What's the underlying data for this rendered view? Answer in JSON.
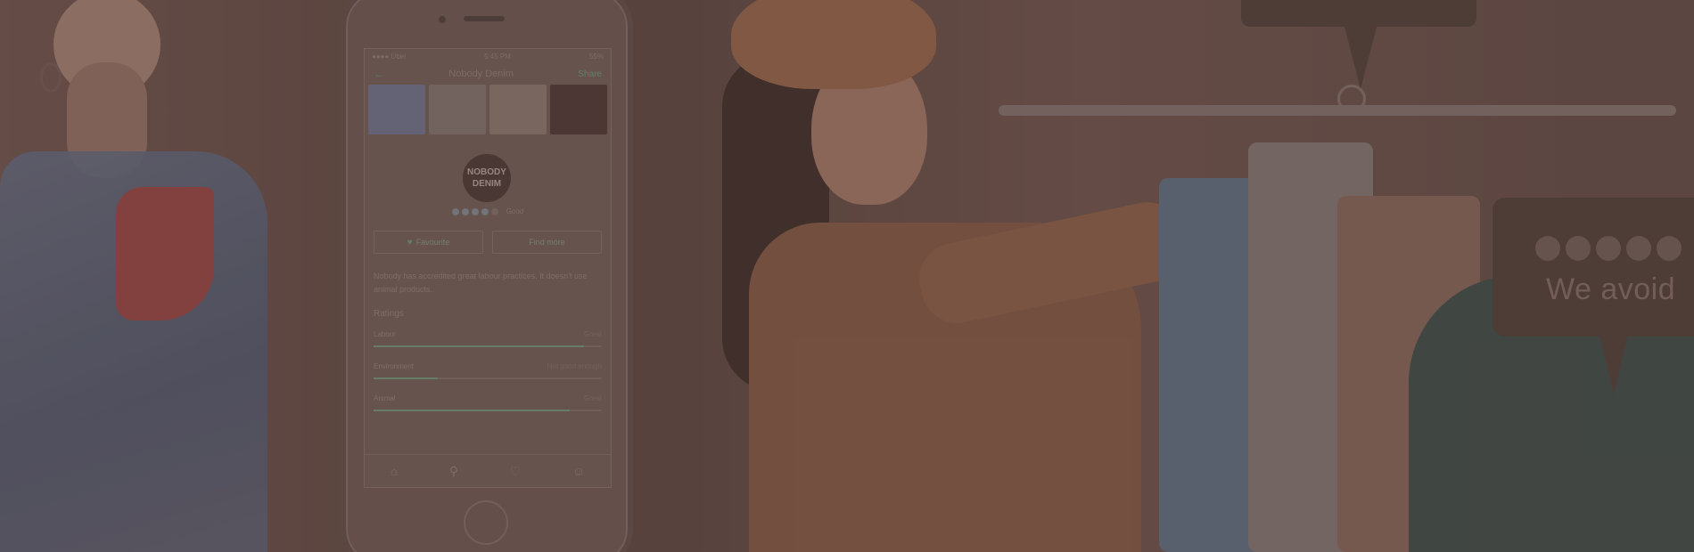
{
  "phone": {
    "status": {
      "carrier": "●●●● Ubel",
      "time": "5:45 PM",
      "battery": "55%"
    },
    "nav": {
      "title": "Nobody Denim",
      "back_icon": "arrow-left-icon",
      "action": "Share"
    },
    "brand_logo": "NOBODY DENIM",
    "rating": {
      "filled": 4,
      "total": 5,
      "label": "Good"
    },
    "buttons": {
      "favourite": "Favourite",
      "find": "Find more"
    },
    "description": "Nobody has accredited great labour practices. It doesn't use animal products.",
    "ratings_title": "Ratings",
    "ratings": [
      {
        "label": "Labour",
        "value": "Great",
        "fill": 0.92
      },
      {
        "label": "Environment",
        "value": "Not good enough",
        "fill": 0.28
      },
      {
        "label": "Animal",
        "value": "Great",
        "fill": 0.86
      }
    ],
    "tabbar_icons": [
      "home-icon",
      "search-icon",
      "heart-icon",
      "profile-icon"
    ]
  },
  "bubble": {
    "dots": 5,
    "text": "We avoid"
  },
  "colors": {
    "accent": "#6e8c72",
    "overlay": "#5a4440"
  }
}
